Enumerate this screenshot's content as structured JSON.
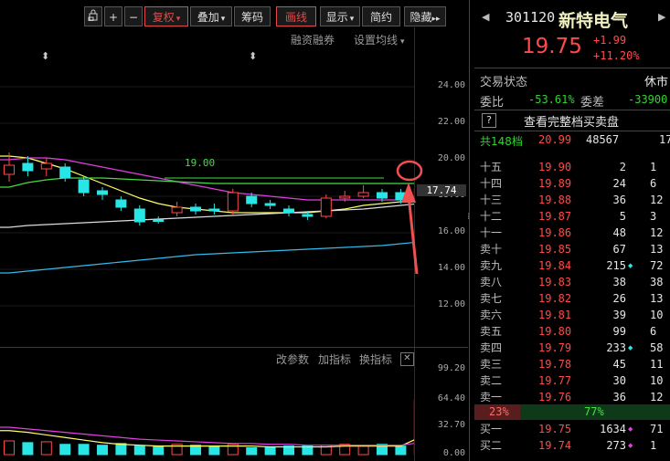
{
  "toolbar": {
    "items": [
      {
        "label": "复权",
        "marker": "▾",
        "color": "#e24a4a",
        "active": true
      },
      {
        "label": "叠加",
        "marker": "▾"
      },
      {
        "label": "筹码"
      },
      {
        "label": "画线",
        "color": "#e24a4a",
        "active": true
      },
      {
        "label": "显示",
        "marker": "▾"
      },
      {
        "label": "简约"
      },
      {
        "label": "隐藏",
        "marker": "▸▸"
      }
    ]
  },
  "chart_links": {
    "margin": "融资融券",
    "ma_settings": "设置均线",
    "ma_settings_marker": "▾"
  },
  "price_line_label": "19.00",
  "current_price_tag": "17.74",
  "indicator_links": {
    "modify": "改参数",
    "add": "加指标",
    "switch": "换指标"
  },
  "quote": {
    "code": "301120",
    "name": "新特电气",
    "price": "19.75",
    "change": "+1.99",
    "change_pct": "+11.20%",
    "status_label": "交易状态",
    "status_value": "休市",
    "ratio_label": "委比",
    "ratio_value": "-53.61%",
    "diff_label": "委差",
    "diff_value": "-33900",
    "help_btn": "?",
    "full_book_label": "查看完整档买卖盘",
    "total_levels": "共148档",
    "total_price": "20.99",
    "total_volume": "48567",
    "total_orders": "17"
  },
  "asks": [
    {
      "label": "十五",
      "price": "19.90",
      "volume": "2",
      "dot": false,
      "orders": "1"
    },
    {
      "label": "十四",
      "price": "19.89",
      "volume": "24",
      "dot": false,
      "orders": "6"
    },
    {
      "label": "十三",
      "price": "19.88",
      "volume": "36",
      "dot": false,
      "orders": "12"
    },
    {
      "label": "十二",
      "price": "19.87",
      "volume": "5",
      "dot": false,
      "orders": "3"
    },
    {
      "label": "十一",
      "price": "19.86",
      "volume": "48",
      "dot": false,
      "orders": "12"
    },
    {
      "label": "卖十",
      "price": "19.85",
      "volume": "67",
      "dot": false,
      "orders": "13"
    },
    {
      "label": "卖九",
      "price": "19.84",
      "volume": "215",
      "dot": true,
      "orders": "72"
    },
    {
      "label": "卖八",
      "price": "19.83",
      "volume": "38",
      "dot": false,
      "orders": "38"
    },
    {
      "label": "卖七",
      "price": "19.82",
      "volume": "26",
      "dot": false,
      "orders": "13"
    },
    {
      "label": "卖六",
      "price": "19.81",
      "volume": "39",
      "dot": false,
      "orders": "10"
    },
    {
      "label": "卖五",
      "price": "19.80",
      "volume": "99",
      "dot": false,
      "orders": "6"
    },
    {
      "label": "卖四",
      "price": "19.79",
      "volume": "233",
      "dot": true,
      "orders": "58"
    },
    {
      "label": "卖三",
      "price": "19.78",
      "volume": "45",
      "dot": false,
      "orders": "11"
    },
    {
      "label": "卖二",
      "price": "19.77",
      "volume": "30",
      "dot": false,
      "orders": "10"
    },
    {
      "label": "卖一",
      "price": "19.76",
      "volume": "36",
      "dot": false,
      "orders": "12"
    }
  ],
  "ratio_bar": {
    "left": "23%",
    "right": "77%"
  },
  "bids": [
    {
      "label": "买一",
      "price": "19.75",
      "volume": "1634",
      "dot": true,
      "orders": "71"
    },
    {
      "label": "买二",
      "price": "19.74",
      "volume": "273",
      "dot": true,
      "orders": "1"
    }
  ],
  "chart_data": [
    {
      "type": "candlestick",
      "y_ticks": [
        "24.00",
        "22.00",
        "20.00",
        "18.00",
        "16.00",
        "14.00",
        "12.00"
      ],
      "ylim": [
        11.0,
        25.5
      ],
      "candles": [
        {
          "o": 19.2,
          "c": 19.7,
          "h": 20.4,
          "l": 18.8,
          "up": true
        },
        {
          "o": 19.8,
          "c": 19.4,
          "h": 20.2,
          "l": 19.1,
          "up": false
        },
        {
          "o": 19.5,
          "c": 19.8,
          "h": 20.1,
          "l": 19.1,
          "up": true
        },
        {
          "o": 19.6,
          "c": 19.0,
          "h": 19.8,
          "l": 18.8,
          "up": false
        },
        {
          "o": 18.9,
          "c": 18.2,
          "h": 19.1,
          "l": 18.0,
          "up": false
        },
        {
          "o": 18.3,
          "c": 18.1,
          "h": 18.5,
          "l": 17.8,
          "up": false
        },
        {
          "o": 17.8,
          "c": 17.4,
          "h": 18.0,
          "l": 17.2,
          "up": false
        },
        {
          "o": 17.3,
          "c": 16.6,
          "h": 17.5,
          "l": 16.4,
          "up": false
        },
        {
          "o": 16.7,
          "c": 16.7,
          "h": 16.9,
          "l": 16.5,
          "up": false
        },
        {
          "o": 17.1,
          "c": 17.4,
          "h": 17.7,
          "l": 16.9,
          "up": true
        },
        {
          "o": 17.4,
          "c": 17.2,
          "h": 17.6,
          "l": 17.0,
          "up": false
        },
        {
          "o": 17.3,
          "c": 17.2,
          "h": 17.6,
          "l": 17.0,
          "up": false
        },
        {
          "o": 17.2,
          "c": 18.2,
          "h": 18.4,
          "l": 17.0,
          "up": true
        },
        {
          "o": 18.0,
          "c": 17.6,
          "h": 18.2,
          "l": 17.4,
          "up": false
        },
        {
          "o": 17.6,
          "c": 17.5,
          "h": 17.8,
          "l": 17.3,
          "up": false
        },
        {
          "o": 17.3,
          "c": 17.1,
          "h": 17.5,
          "l": 16.9,
          "up": false
        },
        {
          "o": 17.0,
          "c": 16.9,
          "h": 17.2,
          "l": 16.7,
          "up": false
        },
        {
          "o": 16.9,
          "c": 17.9,
          "h": 18.1,
          "l": 16.8,
          "up": true
        },
        {
          "o": 17.9,
          "c": 18.0,
          "h": 18.3,
          "l": 17.7,
          "up": true
        },
        {
          "o": 18.0,
          "c": 18.2,
          "h": 18.6,
          "l": 17.9,
          "up": true
        },
        {
          "o": 18.2,
          "c": 17.9,
          "h": 18.4,
          "l": 17.7,
          "up": false
        },
        {
          "o": 18.2,
          "c": 17.8,
          "h": 18.4,
          "l": 17.6,
          "up": false
        },
        {
          "o": 17.9,
          "c": 18.4,
          "h": 20.7,
          "l": 17.8,
          "up": true
        }
      ],
      "series": [
        {
          "color": "#ffff66",
          "values": [
            20.2,
            20.1,
            19.8,
            19.5,
            19.1,
            18.7,
            18.3,
            17.9,
            17.6,
            17.4,
            17.3,
            17.2,
            17.1,
            17.1,
            17.1,
            17.1,
            17.1,
            17.2,
            17.3,
            17.5,
            17.6,
            17.7,
            17.8
          ]
        },
        {
          "color": "#e040e0",
          "values": [
            20.0,
            20.1,
            20.1,
            20.0,
            19.8,
            19.6,
            19.4,
            19.2,
            19.0,
            18.8,
            18.6,
            18.4,
            18.2,
            18.1,
            18.0,
            17.9,
            17.8,
            17.8,
            17.8,
            17.8,
            17.8,
            17.8,
            17.9
          ]
        },
        {
          "color": "#44dd44",
          "values": [
            18.5,
            18.75,
            18.9,
            19.0,
            19.0,
            19.0,
            18.95,
            18.9,
            18.85,
            18.8,
            18.75,
            18.7,
            18.7,
            18.7,
            18.7,
            18.7,
            18.7,
            18.7,
            18.7,
            18.7,
            18.7,
            18.7,
            18.7
          ]
        },
        {
          "color": "#dddddd",
          "values": [
            16.3,
            16.4,
            16.45,
            16.5,
            16.55,
            16.6,
            16.65,
            16.7,
            16.75,
            16.8,
            16.85,
            16.9,
            16.95,
            17.0,
            17.05,
            17.1,
            17.15,
            17.2,
            17.25,
            17.3,
            17.4,
            17.5,
            17.6
          ]
        },
        {
          "color": "#33bbee",
          "values": [
            13.8,
            13.9,
            14.0,
            14.1,
            14.2,
            14.3,
            14.4,
            14.5,
            14.6,
            14.7,
            14.8,
            14.85,
            14.9,
            14.95,
            15.0,
            15.05,
            15.1,
            15.15,
            15.2,
            15.25,
            15.3,
            15.4,
            15.5
          ]
        }
      ],
      "hline": 19.0
    },
    {
      "type": "bar",
      "y_ticks": [
        "99.20",
        "64.40",
        "32.70",
        "0.00"
      ],
      "ylim": [
        0,
        99.2
      ],
      "values": [
        16,
        14,
        15,
        12,
        12,
        11,
        13,
        10,
        10,
        12,
        11,
        10,
        12,
        8,
        9,
        10,
        10,
        11,
        12,
        10,
        12,
        10,
        64
      ],
      "series": [
        {
          "color": "#ffff66",
          "values": [
            28,
            26,
            23,
            20,
            17,
            14,
            12,
            11,
            10,
            10,
            10,
            10,
            10,
            10,
            9,
            9,
            9,
            9,
            10,
            10,
            10,
            10,
            20
          ]
        },
        {
          "color": "#e040e0",
          "values": [
            32,
            30,
            28,
            26,
            24,
            22,
            20,
            18,
            17,
            16,
            15,
            14,
            13,
            13,
            12,
            12,
            11,
            11,
            11,
            11,
            11,
            11,
            14
          ]
        }
      ]
    }
  ]
}
